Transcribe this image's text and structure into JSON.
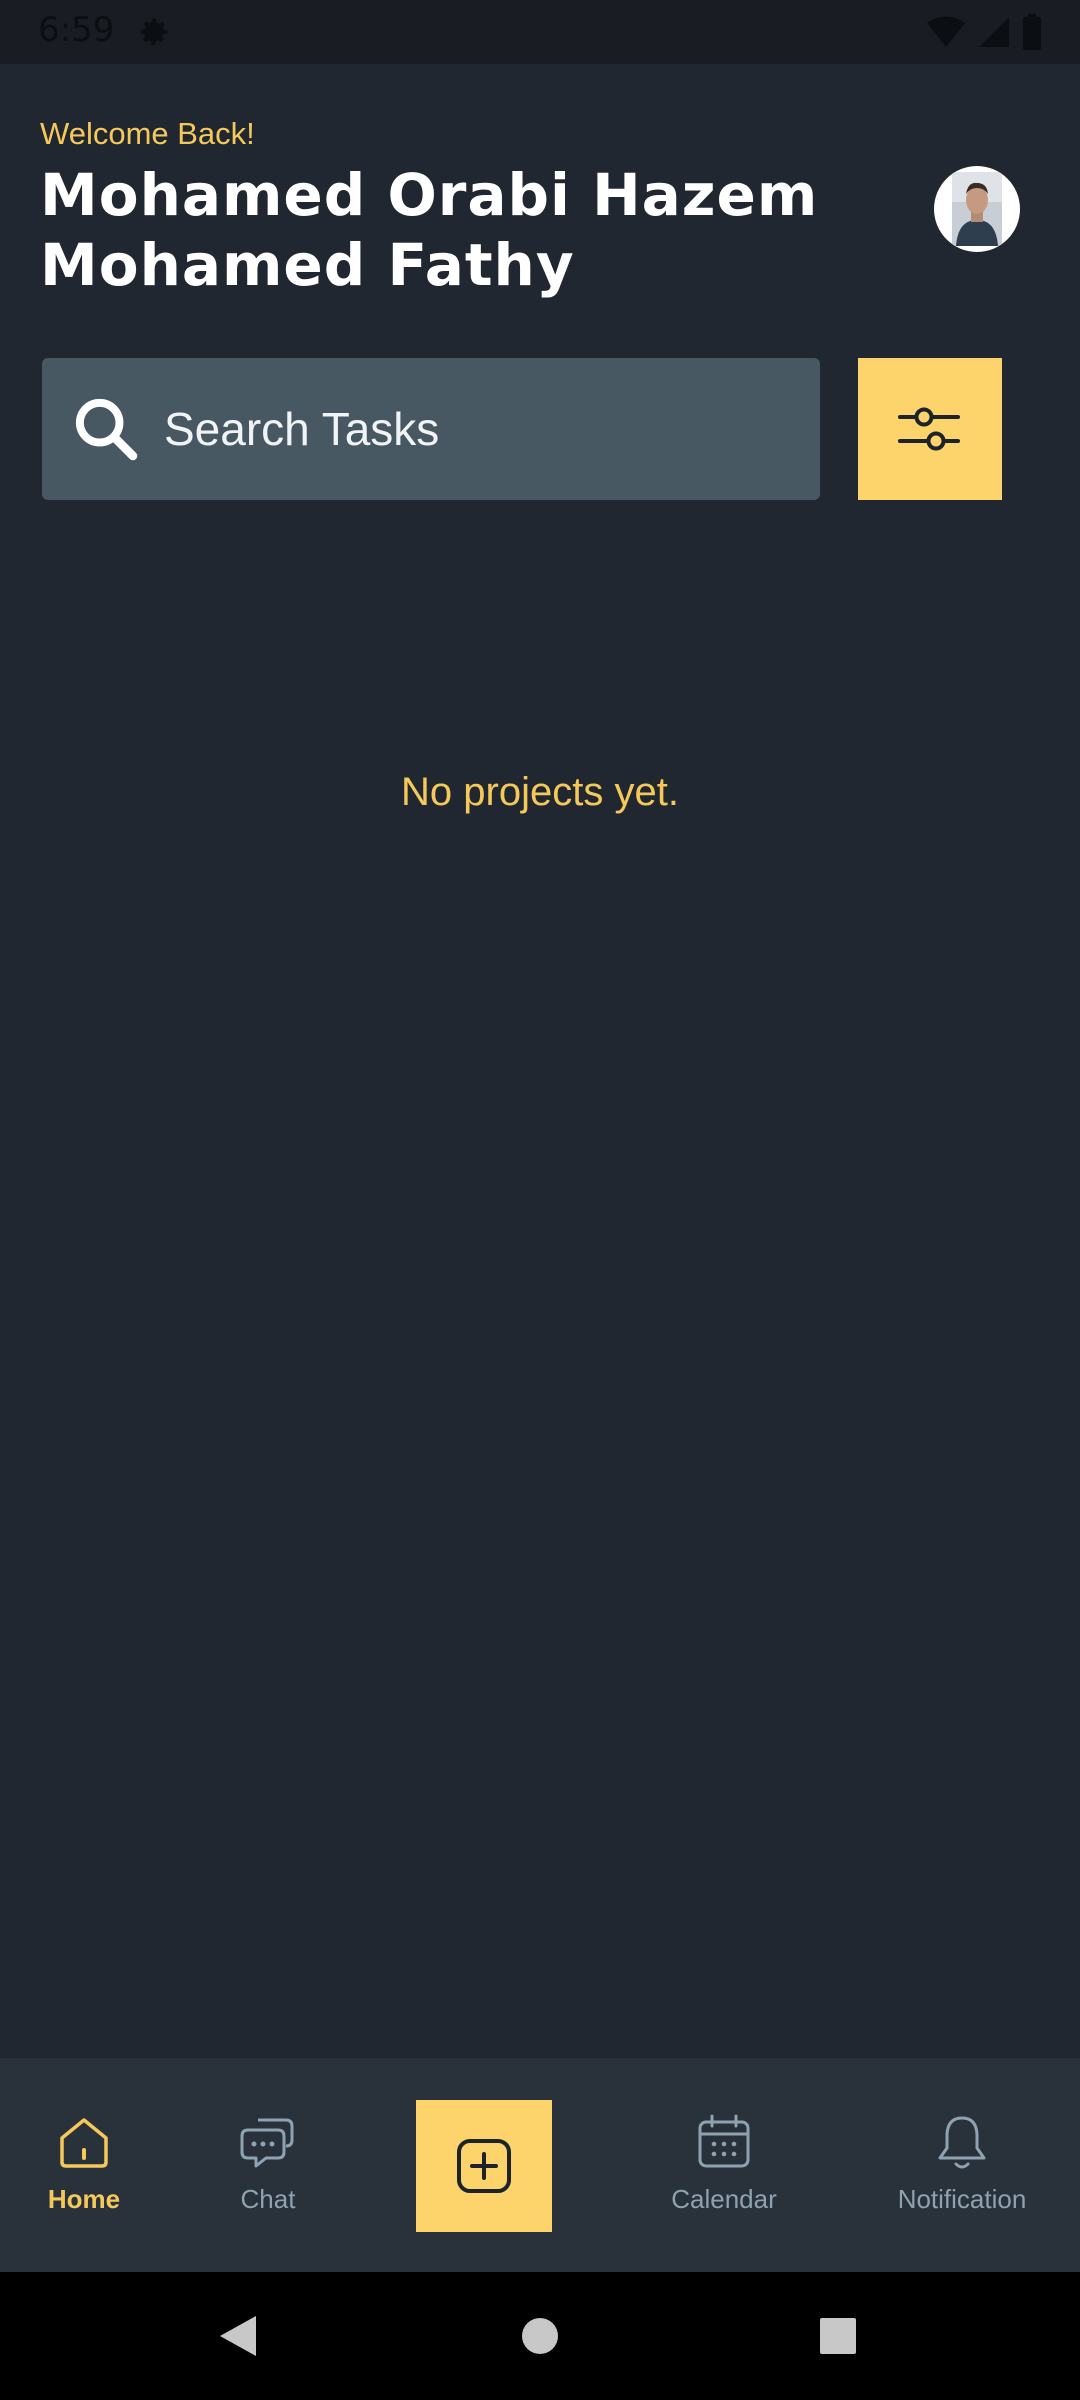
{
  "status_bar": {
    "time": "6:59",
    "icons": [
      "gear-icon",
      "wifi-icon",
      "signal-icon",
      "battery-icon"
    ]
  },
  "header": {
    "welcome": "Welcome Back!",
    "user_name": "Mohamed Orabi Hazem Mohamed Fathy"
  },
  "search": {
    "placeholder": "Search Tasks",
    "value": ""
  },
  "main": {
    "empty_message": "No projects yet."
  },
  "bottom_nav": {
    "items": [
      {
        "label": "Home",
        "icon": "home-icon",
        "active": true
      },
      {
        "label": "Chat",
        "icon": "chat-icon",
        "active": false
      },
      {
        "label": "",
        "icon": "add-square-icon",
        "active": false
      },
      {
        "label": "Calendar",
        "icon": "calendar-icon",
        "active": false
      },
      {
        "label": "Notification",
        "icon": "bell-icon",
        "active": false
      }
    ]
  },
  "colors": {
    "background": "#212731",
    "accent": "#fdd36b",
    "search_bg": "#475863",
    "nav_bg": "#29323a",
    "inactive_nav": "#8ea2b2"
  }
}
